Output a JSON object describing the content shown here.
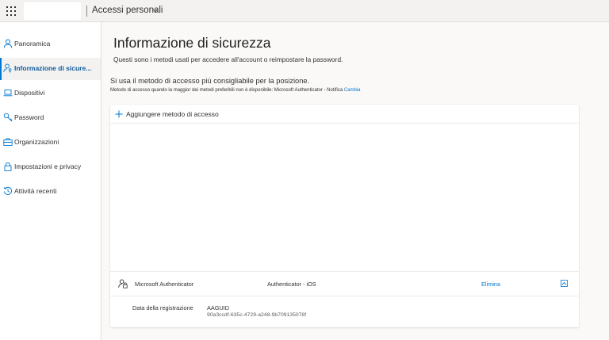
{
  "header": {
    "app_title": "Accessi personali"
  },
  "sidebar": {
    "items": [
      {
        "label": "Panoramica",
        "icon": "person-icon"
      },
      {
        "label": "Informazione di sicure...",
        "icon": "person-key-icon",
        "active": true
      },
      {
        "label": "Dispositivi",
        "icon": "laptop-icon"
      },
      {
        "label": "Password",
        "icon": "key-icon"
      },
      {
        "label": "Organizzazioni",
        "icon": "briefcase-icon"
      },
      {
        "label": "Impostazioni e privacy",
        "icon": "lock-icon"
      },
      {
        "label": "Attività recenti",
        "icon": "history-icon"
      }
    ]
  },
  "main": {
    "title": "Informazione di sicurezza",
    "subtitle": "Questi sono i metodi usati per accedere all'account o reimpostare la password.",
    "default_method_text": "Si usa il metodo di accesso più consigliabile per la posizione.",
    "default_method_note": "Metodo di accesso quando la maggior dei metodi preferibili non è disponibile: Microsoft Authenticator - Notifica",
    "change_link": "Cambia",
    "add_method_label": "Aggiungere metodo di accesso",
    "methods": [
      {
        "name": "Microsoft Authenticator",
        "detail": "Authenticator - iOS",
        "action": "Elimina",
        "registration_label": "Data della registrazione",
        "aaguid_label": "AAGUID",
        "aaguid_value": "90a3ccdf-635c-4729-a248-9b709135078f"
      }
    ]
  },
  "colors": {
    "accent": "#0078d4",
    "active_text": "#0f5a9c",
    "topbar_bg": "#f3f2f1",
    "page_bg": "#faf9f8"
  }
}
